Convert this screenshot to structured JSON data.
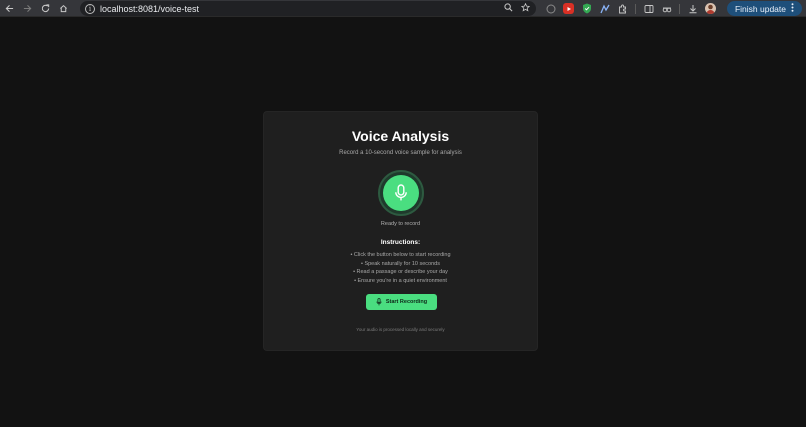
{
  "browser": {
    "url": "localhost:8081/voice-test",
    "finish_update_label": "Finish update"
  },
  "card": {
    "title": "Voice Analysis",
    "subtitle": "Record a 10-second voice sample for analysis",
    "status": "Ready to record",
    "instructions_title": "Instructions:",
    "instructions": [
      "• Click the button below to start recording",
      "• Speak naturally for 10 seconds",
      "• Read a passage or describe your day",
      "• Ensure you're in a quiet environment"
    ],
    "record_button_label": "Start Recording",
    "footer_note": "Your audio is processed locally and securely"
  },
  "colors": {
    "accent": "#4ade80",
    "background": "#121212",
    "card": "#1f1f1f"
  }
}
